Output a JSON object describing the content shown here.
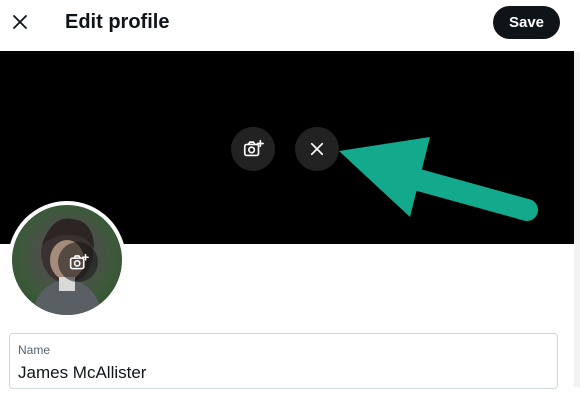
{
  "header": {
    "title": "Edit profile",
    "save_label": "Save",
    "close_icon": "close-icon"
  },
  "banner": {
    "background": "#000000",
    "add_photo_icon": "add-photo-icon",
    "remove_icon": "close-icon",
    "annotation_color": "#12a98c"
  },
  "avatar": {
    "add_photo_icon": "add-photo-icon"
  },
  "name_field": {
    "label": "Name",
    "value": "James McAllister"
  },
  "colors": {
    "primary_button": "#0f1419",
    "border": "#cfd9de",
    "label": "#536471"
  }
}
